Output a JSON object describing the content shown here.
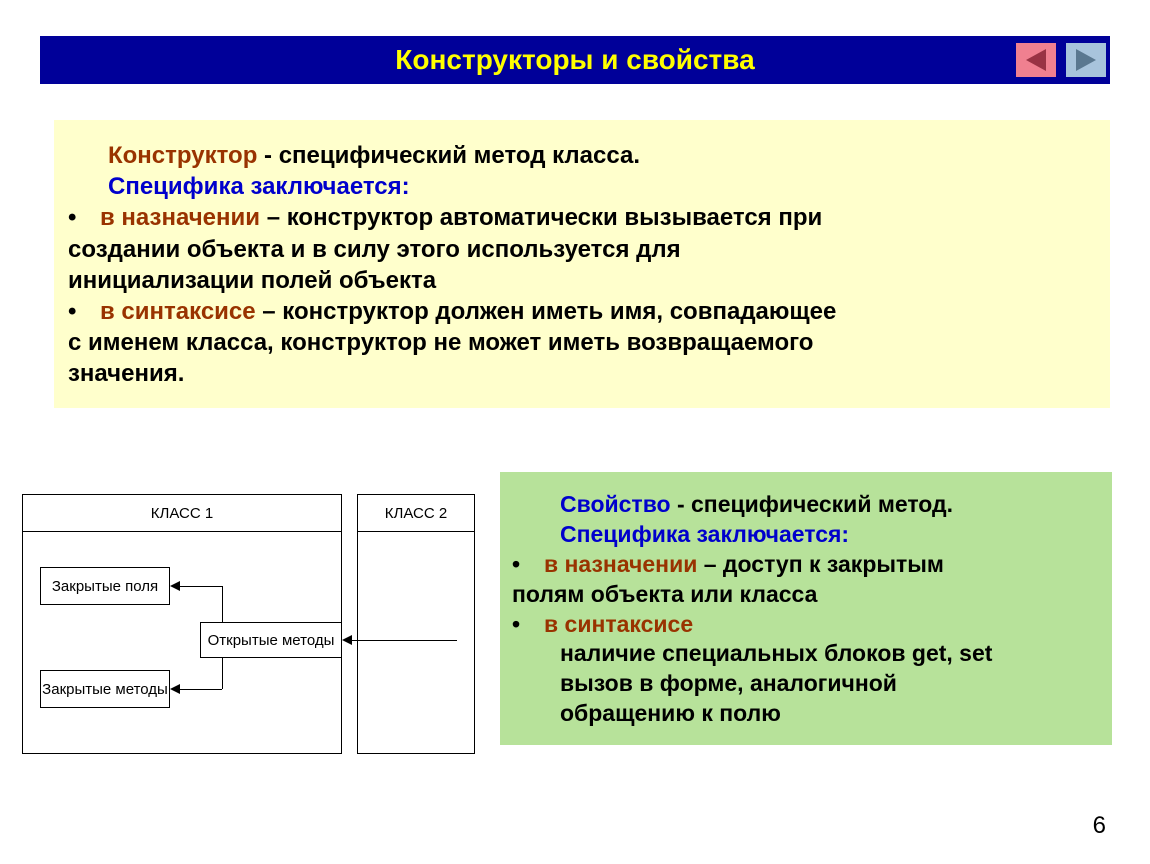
{
  "title": "Конструкторы и свойства",
  "page_number": "6",
  "yellow": {
    "constructor_word": "Конструктор",
    "constructor_rest": " - специфический метод класса.",
    "specific_label": "Специфика заключается:",
    "bullet1_emph": "в назначении",
    "bullet1_rest_a": " – конструктор автоматически вызывается при ",
    "bullet1_rest_b": "создании объекта и в силу этого используется для ",
    "bullet1_rest_c": "инициализации полей объекта",
    "bullet2_emph": "в синтаксисе",
    "bullet2_rest_a": " – конструктор должен иметь имя, совпадающее ",
    "bullet2_rest_b": "с именем класса, конструктор не может иметь возвращаемого ",
    "bullet2_rest_c": "значения."
  },
  "diagram": {
    "class1": "КЛАСС 1",
    "class2": "КЛАСС 2",
    "closed_fields": "Закрытые поля",
    "open_methods": "Открытые методы",
    "closed_methods": "Закрытые методы"
  },
  "green": {
    "property_word": "Свойство",
    "property_rest": " - специфический метод.",
    "specific_label": "Специфика заключается:",
    "bullet1_emph": "в назначении",
    "bullet1_rest_a": " – доступ к закрытым ",
    "bullet1_rest_b": "полям объекта или класса",
    "bullet2_emph": "в синтаксисе",
    "sub1": "наличие специальных блоков get, set",
    "sub2": "вызов в форме, аналогичной ",
    "sub3": "обращению к полю"
  }
}
